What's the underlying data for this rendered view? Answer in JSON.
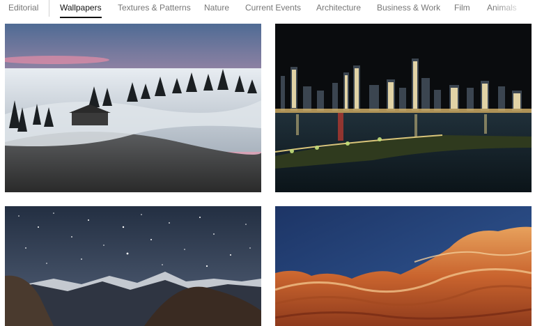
{
  "nav": {
    "items": [
      {
        "label": "Editorial",
        "active": false
      },
      {
        "label": "Wallpapers",
        "active": true
      },
      {
        "label": "Textures & Patterns",
        "active": false
      },
      {
        "label": "Nature",
        "active": false
      },
      {
        "label": "Current Events",
        "active": false
      },
      {
        "label": "Architecture",
        "active": false
      },
      {
        "label": "Business & Work",
        "active": false
      },
      {
        "label": "Film",
        "active": false
      },
      {
        "label": "Animals",
        "active": false
      }
    ]
  },
  "photos": [
    {
      "subject": "foggy hill with pine trees at dusk"
    },
    {
      "subject": "city skyline at night across the water"
    },
    {
      "subject": "starry night sky over mountain range"
    },
    {
      "subject": "red sandstone rock formations"
    }
  ]
}
